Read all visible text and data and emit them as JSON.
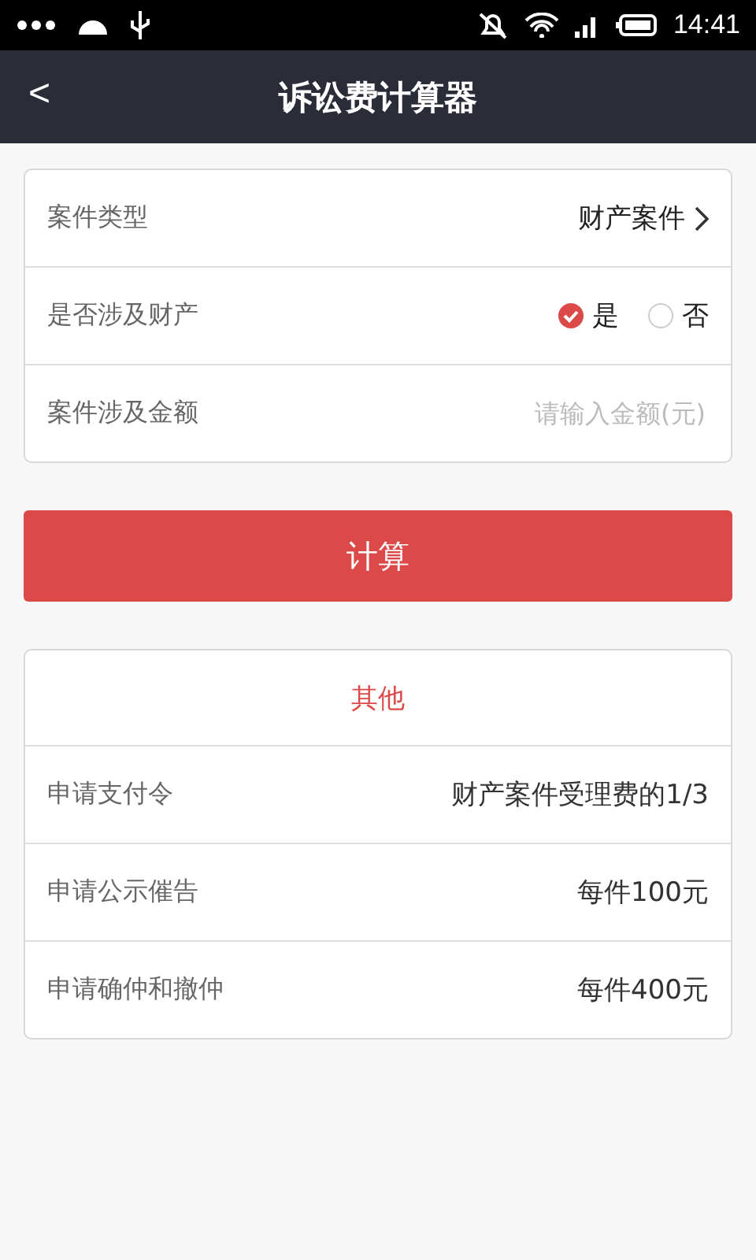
{
  "status_bar": {
    "time": "14:41"
  },
  "header": {
    "back": "<",
    "title": "诉讼费计算器"
  },
  "form": {
    "case_type": {
      "label": "案件类型",
      "value": "财产案件"
    },
    "property": {
      "label": "是否涉及财产",
      "options": [
        {
          "label": "是",
          "selected": true
        },
        {
          "label": "否",
          "selected": false
        }
      ]
    },
    "amount": {
      "label": "案件涉及金额",
      "placeholder": "请输入金额(元)"
    }
  },
  "calculate_button": "计算",
  "others": {
    "title": "其他",
    "rows": [
      {
        "label": "申请支付令",
        "value": "财产案件受理费的1/3"
      },
      {
        "label": "申请公示催告",
        "value": "每件100元"
      },
      {
        "label": "申请确仲和撤仲",
        "value": "每件400元"
      }
    ]
  }
}
